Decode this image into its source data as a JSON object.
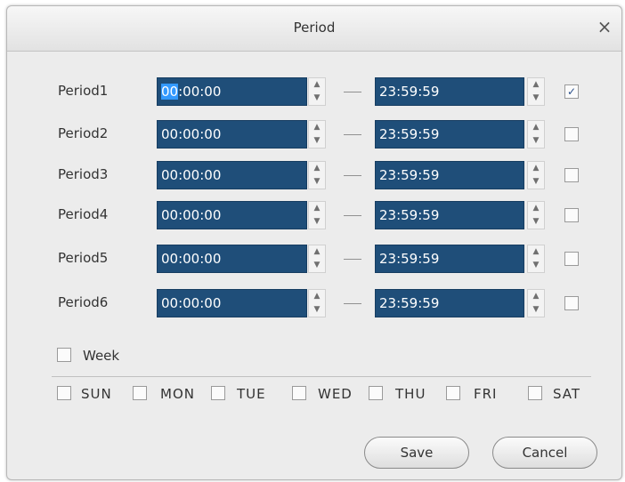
{
  "dialog": {
    "title": "Period",
    "close_glyph": "×"
  },
  "periods": [
    {
      "label": "Period1",
      "start_sel": "00",
      "start_rest": ":00:00",
      "end": "23:59:59",
      "checked": true
    },
    {
      "label": "Period2",
      "start": "00:00:00",
      "end": "23:59:59",
      "checked": false
    },
    {
      "label": "Period3",
      "start": "00:00:00",
      "end": "23:59:59",
      "checked": false
    },
    {
      "label": "Period4",
      "start": "00:00:00",
      "end": "23:59:59",
      "checked": false
    },
    {
      "label": "Period5",
      "start": "00:00:00",
      "end": "23:59:59",
      "checked": false
    },
    {
      "label": "Period6",
      "start": "00:00:00",
      "end": "23:59:59",
      "checked": false
    }
  ],
  "spin": {
    "up": "▲",
    "down": "▼",
    "check": "✓"
  },
  "week": {
    "label": "Week",
    "checked": false
  },
  "days": [
    {
      "label": "SUN",
      "checked": false
    },
    {
      "label": "MON",
      "checked": false
    },
    {
      "label": "TUE",
      "checked": false
    },
    {
      "label": "WED",
      "checked": false
    },
    {
      "label": "THU",
      "checked": false
    },
    {
      "label": "FRI",
      "checked": false
    },
    {
      "label": "SAT",
      "checked": false
    }
  ],
  "buttons": {
    "save": "Save",
    "cancel": "Cancel"
  },
  "colors": {
    "time_field_bg": "#1f4e79",
    "selection": "#3399ff",
    "dialog_bg": "#ececec"
  }
}
